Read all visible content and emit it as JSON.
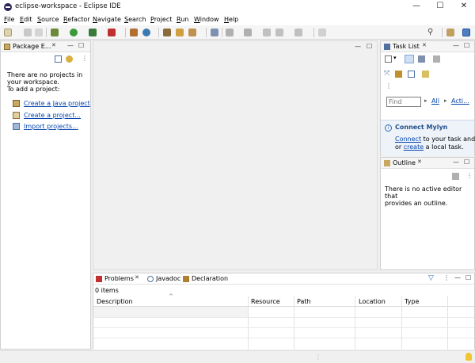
{
  "window": {
    "title": "eclipse-workspace - Eclipse IDE",
    "minimize": "—",
    "maximize": "☐",
    "close": "✕"
  },
  "menu": [
    "File",
    "Edit",
    "Source",
    "Refactor",
    "Navigate",
    "Search",
    "Project",
    "Run",
    "Window",
    "Help"
  ],
  "package_explorer": {
    "tab_label": "Package E...",
    "message_line1": "There are no projects in",
    "message_line2": "your workspace.",
    "message_line3": "To add a project:",
    "links": [
      "Create a Java project",
      "Create a project...",
      "Import projects..."
    ]
  },
  "task_list": {
    "tab_label": "Task List",
    "find_placeholder": "Find",
    "filter_all": "All",
    "filter_activate": "Acti...",
    "connect_title": "Connect Mylyn",
    "connect_link": "Connect",
    "connect_text1": " to your task and AL",
    "connect_or": "or ",
    "connect_create": "create",
    "connect_text2": " a local task."
  },
  "outline": {
    "tab_label": "Outline",
    "message_line1": "There is no active editor that",
    "message_line2": "provides an outline."
  },
  "bottom_panel": {
    "tabs": [
      "Problems",
      "Javadoc",
      "Declaration"
    ],
    "item_count": "0 items",
    "columns": [
      "Description",
      "Resource",
      "Path",
      "Location",
      "Type"
    ]
  },
  "colors": {
    "accent": "#0645ad",
    "background": "#f0f0f0"
  }
}
